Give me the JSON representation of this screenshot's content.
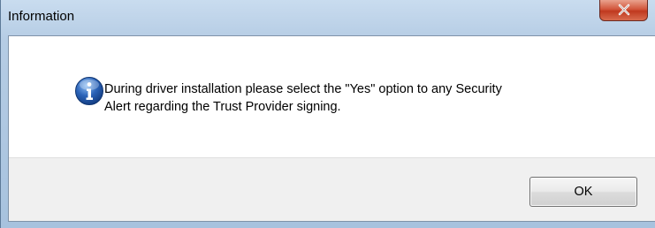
{
  "window": {
    "title": "Information"
  },
  "dialog": {
    "message_line1": "During driver installation please select the \"Yes\" option to any Security",
    "message_line2": "Alert regarding the Trust Provider signing.",
    "icon": "info-icon"
  },
  "buttons": {
    "ok_label": "OK",
    "close_icon": "close-icon"
  },
  "colors": {
    "title_bar": "#b5cce4",
    "close_button": "#c0391f",
    "info_icon_blue": "#2b63b8",
    "button_strip": "#f0f0f0"
  }
}
